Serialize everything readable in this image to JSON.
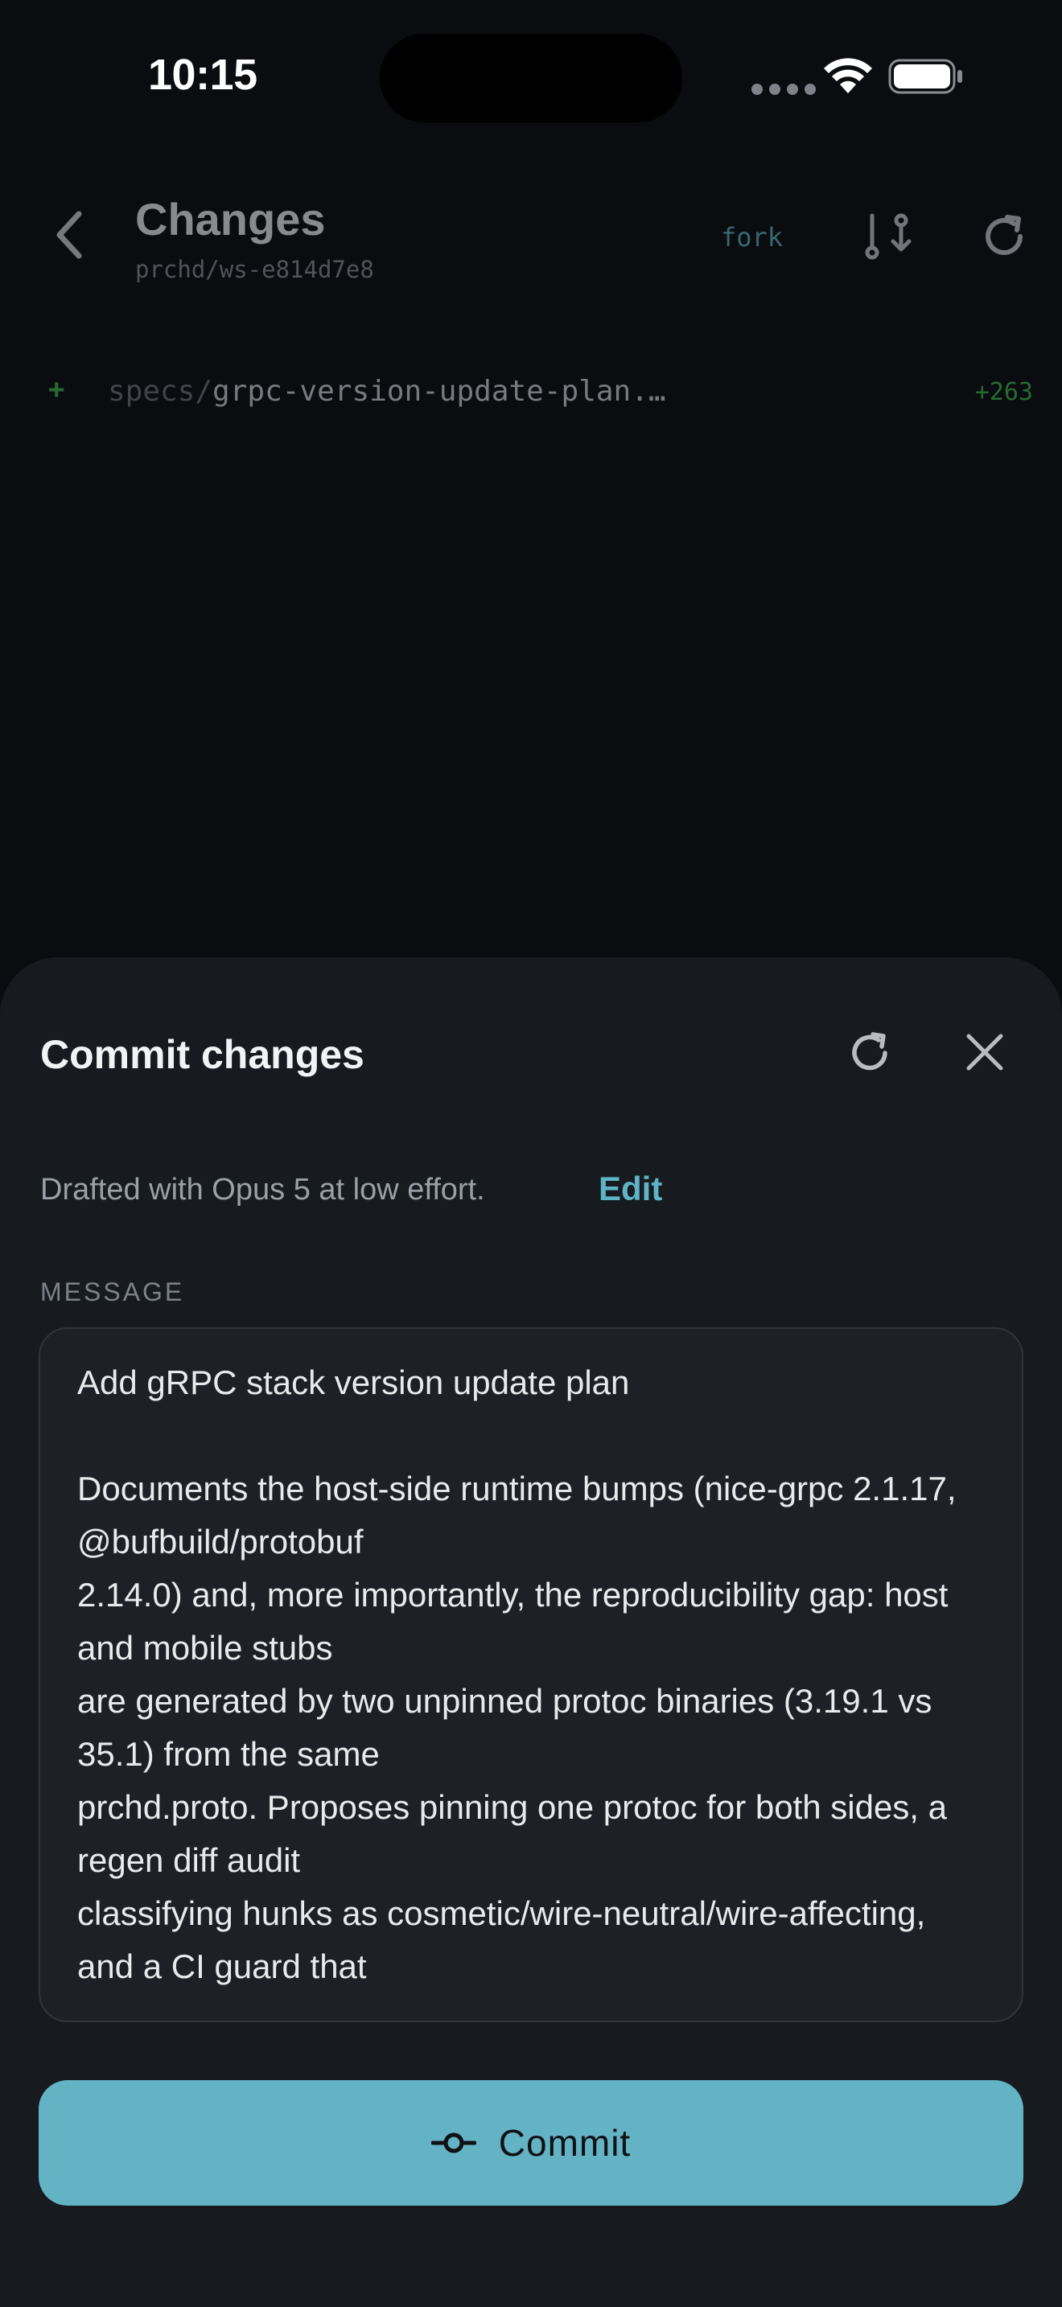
{
  "status_bar": {
    "time": "10:15"
  },
  "header": {
    "title": "Changes",
    "subtitle": "prchd/ws-e814d7e8",
    "fork_label": "fork"
  },
  "files": [
    {
      "status": "+",
      "dir": "specs/",
      "name": "grpc-version-update-plan.…",
      "additions": "+263"
    }
  ],
  "sheet": {
    "title": "Commit changes",
    "draft_note": "Drafted with Opus 5 at low effort.",
    "edit_label": "Edit",
    "message_label": "MESSAGE",
    "message": "Add gRPC stack version update plan\n\nDocuments the host-side runtime bumps (nice-grpc 2.1.17, @bufbuild/protobuf\n2.14.0) and, more importantly, the reproducibility gap: host and mobile stubs\nare generated by two unpinned protoc binaries (3.19.1 vs 35.1) from the same\nprchd.proto. Proposes pinning one protoc for both sides, a regen diff audit\nclassifying hunks as cosmetic/wire-neutral/wire-affecting, and a CI guard that",
    "commit_label": "Commit"
  },
  "colors": {
    "accent": "#63b3c4",
    "addition": "#3fb950",
    "background": "#0b0c0f",
    "sheet": "#171a1f"
  }
}
